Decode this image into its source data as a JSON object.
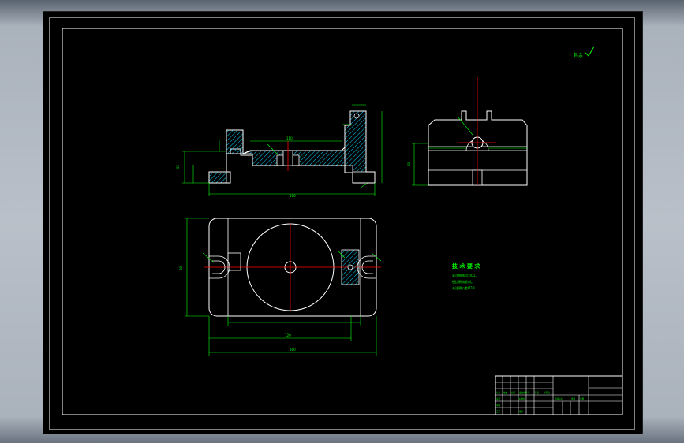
{
  "drawing": {
    "corner_note": "其余",
    "tech_req": {
      "title": "技 术 要 求",
      "lines": [
        "未注倒角均为C1。",
        "锐边倒钝毛刺。",
        "未注明公差IT13"
      ]
    },
    "dims": {
      "front_height": "95",
      "front_width": "160",
      "front_top": "110",
      "side_height": "60",
      "plan_height": "80",
      "plan_inner": "120",
      "plan_total": "160"
    },
    "title_block": {
      "cells": [
        "标记",
        "处数",
        "分区",
        "更改文件号",
        "签名",
        "年月日",
        "设计",
        "标准化",
        "阶段标记",
        "重量",
        "比例",
        "审核",
        "工艺",
        "批准"
      ]
    }
  },
  "colors": {
    "background": "#000000",
    "frame": "#ffffff",
    "outline": "#ffffff",
    "dimension": "#00ff00",
    "centerline": "#ff0000",
    "hatch": "#00d0ff"
  }
}
